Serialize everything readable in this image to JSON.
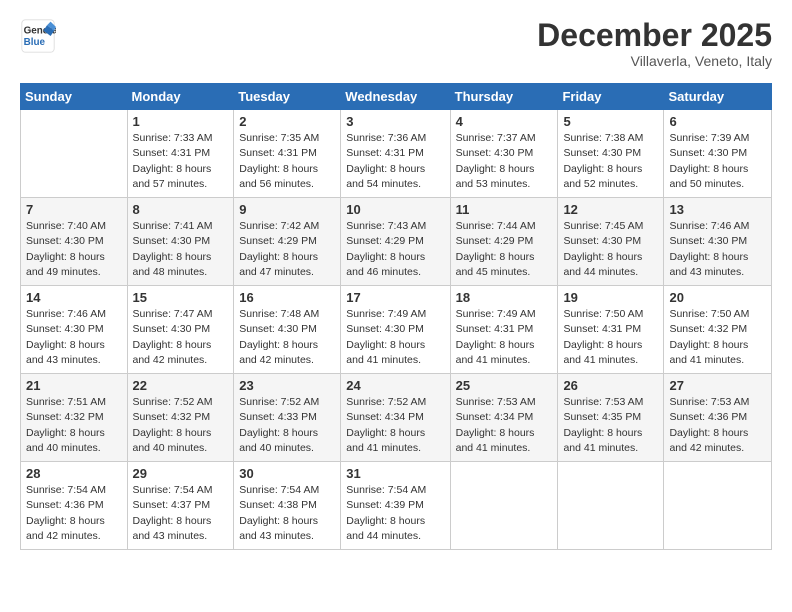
{
  "logo": {
    "general": "General",
    "blue": "Blue"
  },
  "header": {
    "month": "December 2025",
    "location": "Villaverla, Veneto, Italy"
  },
  "weekdays": [
    "Sunday",
    "Monday",
    "Tuesday",
    "Wednesday",
    "Thursday",
    "Friday",
    "Saturday"
  ],
  "weeks": [
    [
      {
        "day": "",
        "info": ""
      },
      {
        "day": "1",
        "info": "Sunrise: 7:33 AM\nSunset: 4:31 PM\nDaylight: 8 hours\nand 57 minutes."
      },
      {
        "day": "2",
        "info": "Sunrise: 7:35 AM\nSunset: 4:31 PM\nDaylight: 8 hours\nand 56 minutes."
      },
      {
        "day": "3",
        "info": "Sunrise: 7:36 AM\nSunset: 4:31 PM\nDaylight: 8 hours\nand 54 minutes."
      },
      {
        "day": "4",
        "info": "Sunrise: 7:37 AM\nSunset: 4:30 PM\nDaylight: 8 hours\nand 53 minutes."
      },
      {
        "day": "5",
        "info": "Sunrise: 7:38 AM\nSunset: 4:30 PM\nDaylight: 8 hours\nand 52 minutes."
      },
      {
        "day": "6",
        "info": "Sunrise: 7:39 AM\nSunset: 4:30 PM\nDaylight: 8 hours\nand 50 minutes."
      }
    ],
    [
      {
        "day": "7",
        "info": "Sunrise: 7:40 AM\nSunset: 4:30 PM\nDaylight: 8 hours\nand 49 minutes."
      },
      {
        "day": "8",
        "info": "Sunrise: 7:41 AM\nSunset: 4:30 PM\nDaylight: 8 hours\nand 48 minutes."
      },
      {
        "day": "9",
        "info": "Sunrise: 7:42 AM\nSunset: 4:29 PM\nDaylight: 8 hours\nand 47 minutes."
      },
      {
        "day": "10",
        "info": "Sunrise: 7:43 AM\nSunset: 4:29 PM\nDaylight: 8 hours\nand 46 minutes."
      },
      {
        "day": "11",
        "info": "Sunrise: 7:44 AM\nSunset: 4:29 PM\nDaylight: 8 hours\nand 45 minutes."
      },
      {
        "day": "12",
        "info": "Sunrise: 7:45 AM\nSunset: 4:30 PM\nDaylight: 8 hours\nand 44 minutes."
      },
      {
        "day": "13",
        "info": "Sunrise: 7:46 AM\nSunset: 4:30 PM\nDaylight: 8 hours\nand 43 minutes."
      }
    ],
    [
      {
        "day": "14",
        "info": "Sunrise: 7:46 AM\nSunset: 4:30 PM\nDaylight: 8 hours\nand 43 minutes."
      },
      {
        "day": "15",
        "info": "Sunrise: 7:47 AM\nSunset: 4:30 PM\nDaylight: 8 hours\nand 42 minutes."
      },
      {
        "day": "16",
        "info": "Sunrise: 7:48 AM\nSunset: 4:30 PM\nDaylight: 8 hours\nand 42 minutes."
      },
      {
        "day": "17",
        "info": "Sunrise: 7:49 AM\nSunset: 4:30 PM\nDaylight: 8 hours\nand 41 minutes."
      },
      {
        "day": "18",
        "info": "Sunrise: 7:49 AM\nSunset: 4:31 PM\nDaylight: 8 hours\nand 41 minutes."
      },
      {
        "day": "19",
        "info": "Sunrise: 7:50 AM\nSunset: 4:31 PM\nDaylight: 8 hours\nand 41 minutes."
      },
      {
        "day": "20",
        "info": "Sunrise: 7:50 AM\nSunset: 4:32 PM\nDaylight: 8 hours\nand 41 minutes."
      }
    ],
    [
      {
        "day": "21",
        "info": "Sunrise: 7:51 AM\nSunset: 4:32 PM\nDaylight: 8 hours\nand 40 minutes."
      },
      {
        "day": "22",
        "info": "Sunrise: 7:52 AM\nSunset: 4:32 PM\nDaylight: 8 hours\nand 40 minutes."
      },
      {
        "day": "23",
        "info": "Sunrise: 7:52 AM\nSunset: 4:33 PM\nDaylight: 8 hours\nand 40 minutes."
      },
      {
        "day": "24",
        "info": "Sunrise: 7:52 AM\nSunset: 4:34 PM\nDaylight: 8 hours\nand 41 minutes."
      },
      {
        "day": "25",
        "info": "Sunrise: 7:53 AM\nSunset: 4:34 PM\nDaylight: 8 hours\nand 41 minutes."
      },
      {
        "day": "26",
        "info": "Sunrise: 7:53 AM\nSunset: 4:35 PM\nDaylight: 8 hours\nand 41 minutes."
      },
      {
        "day": "27",
        "info": "Sunrise: 7:53 AM\nSunset: 4:36 PM\nDaylight: 8 hours\nand 42 minutes."
      }
    ],
    [
      {
        "day": "28",
        "info": "Sunrise: 7:54 AM\nSunset: 4:36 PM\nDaylight: 8 hours\nand 42 minutes."
      },
      {
        "day": "29",
        "info": "Sunrise: 7:54 AM\nSunset: 4:37 PM\nDaylight: 8 hours\nand 43 minutes."
      },
      {
        "day": "30",
        "info": "Sunrise: 7:54 AM\nSunset: 4:38 PM\nDaylight: 8 hours\nand 43 minutes."
      },
      {
        "day": "31",
        "info": "Sunrise: 7:54 AM\nSunset: 4:39 PM\nDaylight: 8 hours\nand 44 minutes."
      },
      {
        "day": "",
        "info": ""
      },
      {
        "day": "",
        "info": ""
      },
      {
        "day": "",
        "info": ""
      }
    ]
  ]
}
